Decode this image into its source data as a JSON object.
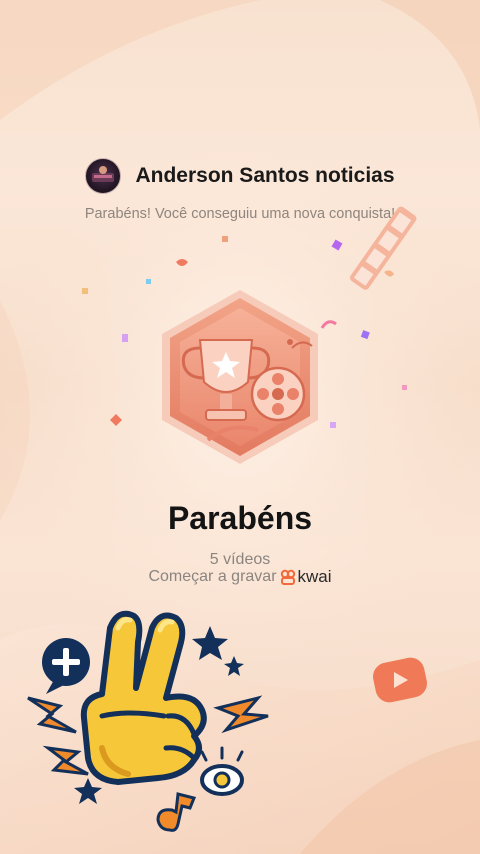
{
  "header": {
    "username": "Anderson Santos noticias",
    "subtitle": "Parabéns! Você conseguiu uma nova conquista!"
  },
  "achievement": {
    "title": "Parabéns",
    "count_text": "5 vídeos",
    "record_label": "Começar a gravar",
    "brand": "kwai"
  },
  "icons": {
    "badge": "trophy-film-badge-icon",
    "sticker": "peace-hand-sticker-icon",
    "play": "play-button-icon",
    "brand": "kwai-logo-icon"
  },
  "colors": {
    "accent": "#f06a4a",
    "badge": "#e9866f",
    "title": "#141414",
    "muted": "#8a8580"
  }
}
